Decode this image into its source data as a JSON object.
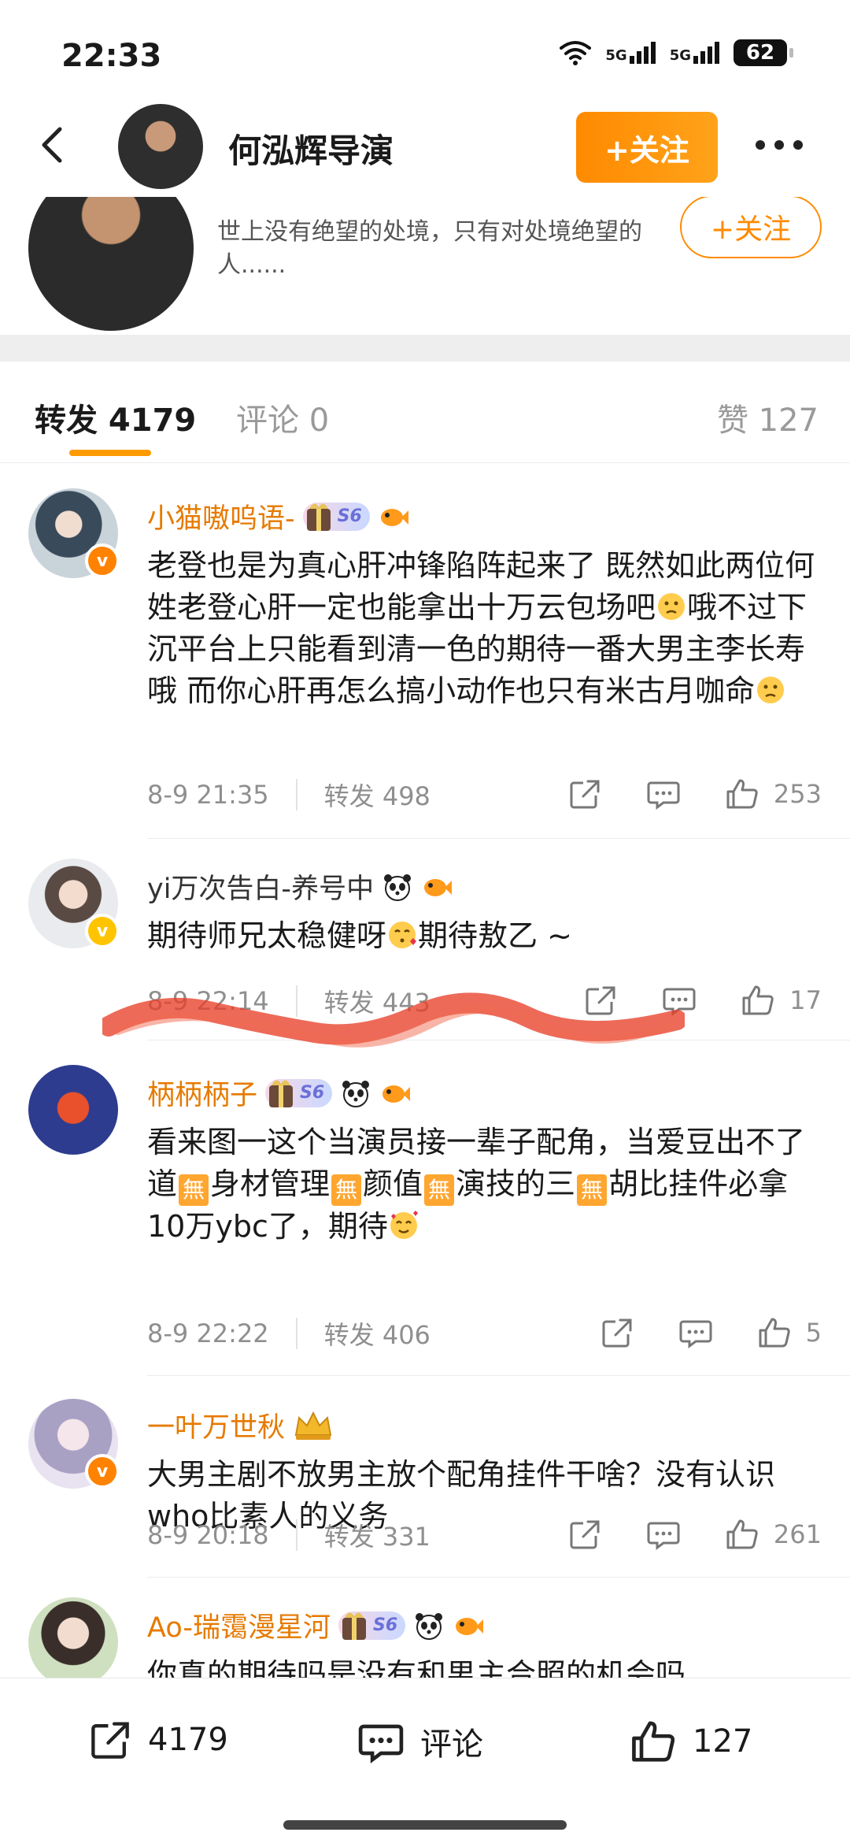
{
  "status_bar": {
    "time": "22:33",
    "network1": "5G",
    "network2": "5G",
    "battery": "62"
  },
  "header": {
    "user_name": "何泓辉导演",
    "follow_label": "+关注"
  },
  "profile_card": {
    "quote": "世上没有绝望的处境，只有对处境绝望的人......",
    "follow_label": "+关注"
  },
  "tabs": {
    "repost": "转发 4179",
    "comment": "评论 0",
    "like": "赞 127"
  },
  "posts": [
    {
      "name": "小猫嗷呜语-",
      "level": "S6",
      "text": [
        "老登也是为真心肝冲锋陷阵起来了 既然如此两位何姓老登心肝一定也能拿出十万云包场吧",
        "哦不过下沉平台上只能看到清一色的期待一番大男主李长寿哦 而你心肝再怎么搞小动作也只有米古月咖命"
      ],
      "time": "8-9 21:35",
      "reposts": "转发 498",
      "likes": "253"
    },
    {
      "name": "yi万次告白-养号中",
      "text": [
        "期待师兄太稳健呀",
        "期待敖乙 ~"
      ],
      "time": "8-9 22:14",
      "reposts": "转发 443",
      "likes": "17"
    },
    {
      "name": "柄柄柄子",
      "level": "S6",
      "text": [
        "看来图一这个当演员接一辈子配角，当爱豆出不了道",
        "身材管理",
        "颜值",
        "演技的三",
        "胡比挂件必拿10万ybc了，期待"
      ],
      "wu": "無",
      "time": "8-9 22:22",
      "reposts": "转发 406",
      "likes": "5"
    },
    {
      "name": "一叶万世秋",
      "text": [
        "大男主剧不放男主放个配角挂件干啥？没有认识who比素人的义务"
      ],
      "time": "8-9 20:18",
      "reposts": "转发 331",
      "likes": "261"
    },
    {
      "name": "Ao-瑞霭漫星河",
      "level": "S6",
      "text": [
        "你真的期待吗是没有和男主合照的机会吗"
      ]
    }
  ],
  "bottom_bar": {
    "repost_count": "4179",
    "comment_label": "评论",
    "like_count": "127"
  },
  "colors": {
    "accent": "#ff8a00",
    "username": "#e67a00",
    "annotation": "#e8402a"
  },
  "icons": [
    "back-icon",
    "wifi-icon",
    "signal-icon",
    "battery-icon",
    "more-icon",
    "share-icon",
    "comment-icon",
    "like-icon"
  ]
}
